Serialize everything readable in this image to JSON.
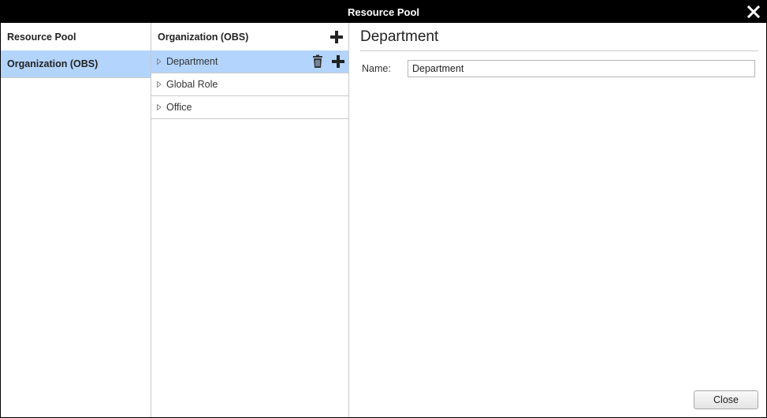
{
  "window": {
    "title": "Resource Pool"
  },
  "nav": {
    "header": "Resource Pool",
    "items": [
      {
        "label": "Organization (OBS)",
        "selected": true
      }
    ]
  },
  "tree": {
    "header": "Organization (OBS)",
    "items": [
      {
        "label": "Department",
        "selected": true
      },
      {
        "label": "Global Role",
        "selected": false
      },
      {
        "label": "Office",
        "selected": false
      }
    ]
  },
  "detail": {
    "title": "Department",
    "name_label": "Name:",
    "name_value": "Department"
  },
  "footer": {
    "close_label": "Close"
  },
  "colors": {
    "selection": "#b3d4fc",
    "titlebar": "#000000",
    "border": "#c9c9c9"
  },
  "icons": {
    "close": "close-icon",
    "add": "plus-icon",
    "delete": "trash-icon",
    "expand": "caret-right-icon"
  }
}
